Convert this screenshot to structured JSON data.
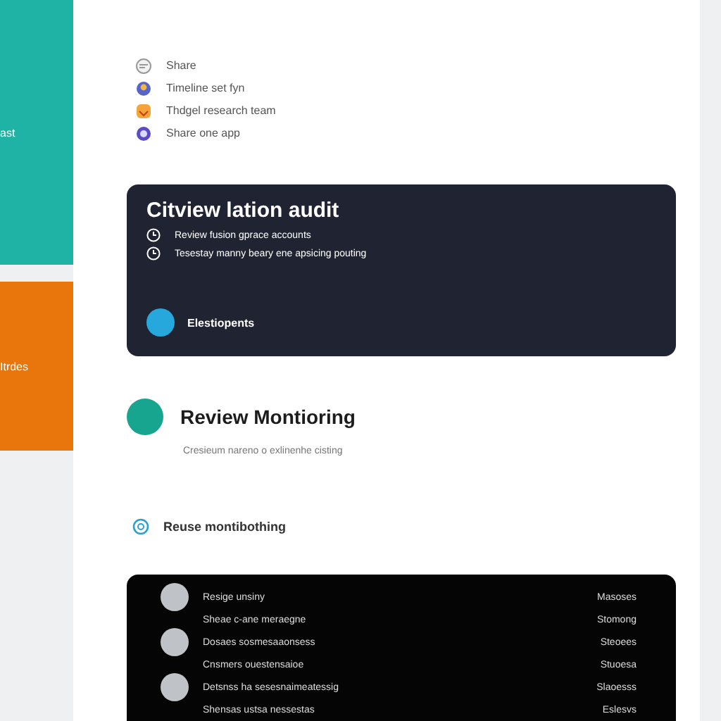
{
  "sidebar": {
    "items": [
      {
        "label": "ast",
        "color": "#1fb3a6"
      },
      {
        "label": "Itrdes",
        "color": "#e8760c"
      }
    ]
  },
  "menu": {
    "items": [
      {
        "label": "Share",
        "kind": "chat"
      },
      {
        "label": "Timeline set  fyn",
        "kind": "user"
      },
      {
        "label": "Thdgel research team",
        "kind": "bag"
      },
      {
        "label": "Share one app",
        "kind": "shield"
      }
    ]
  },
  "audit_card": {
    "title": "Citview lation audit",
    "lines": [
      "Review fusion gprace accounts",
      "Tesestay manny beary ene apsicing pouting"
    ],
    "action": "Elestiopents"
  },
  "review": {
    "title": "Review Montioring",
    "subtitle": "Cresieum nareno o exlinenhe cisting",
    "link": "Reuse montibothing"
  },
  "list": {
    "rows": [
      {
        "label": "Resige unsiny",
        "value": "Masoses",
        "avatar": true
      },
      {
        "label": "Sheae c-ane meraegne",
        "value": "Stomong",
        "avatar": false
      },
      {
        "label": "Dosaes sosmesaaonsess",
        "value": "Steoees",
        "avatar": true
      },
      {
        "label": "Cnsmers ouestensaioe",
        "value": "Stuoesa",
        "avatar": false
      },
      {
        "label": "Detsnss ha sesesnaimeatessig",
        "value": "Slaoesss",
        "avatar": true
      },
      {
        "label": "Shensas ustsa nessestas",
        "value": "Eslesvs",
        "avatar": false
      }
    ]
  }
}
